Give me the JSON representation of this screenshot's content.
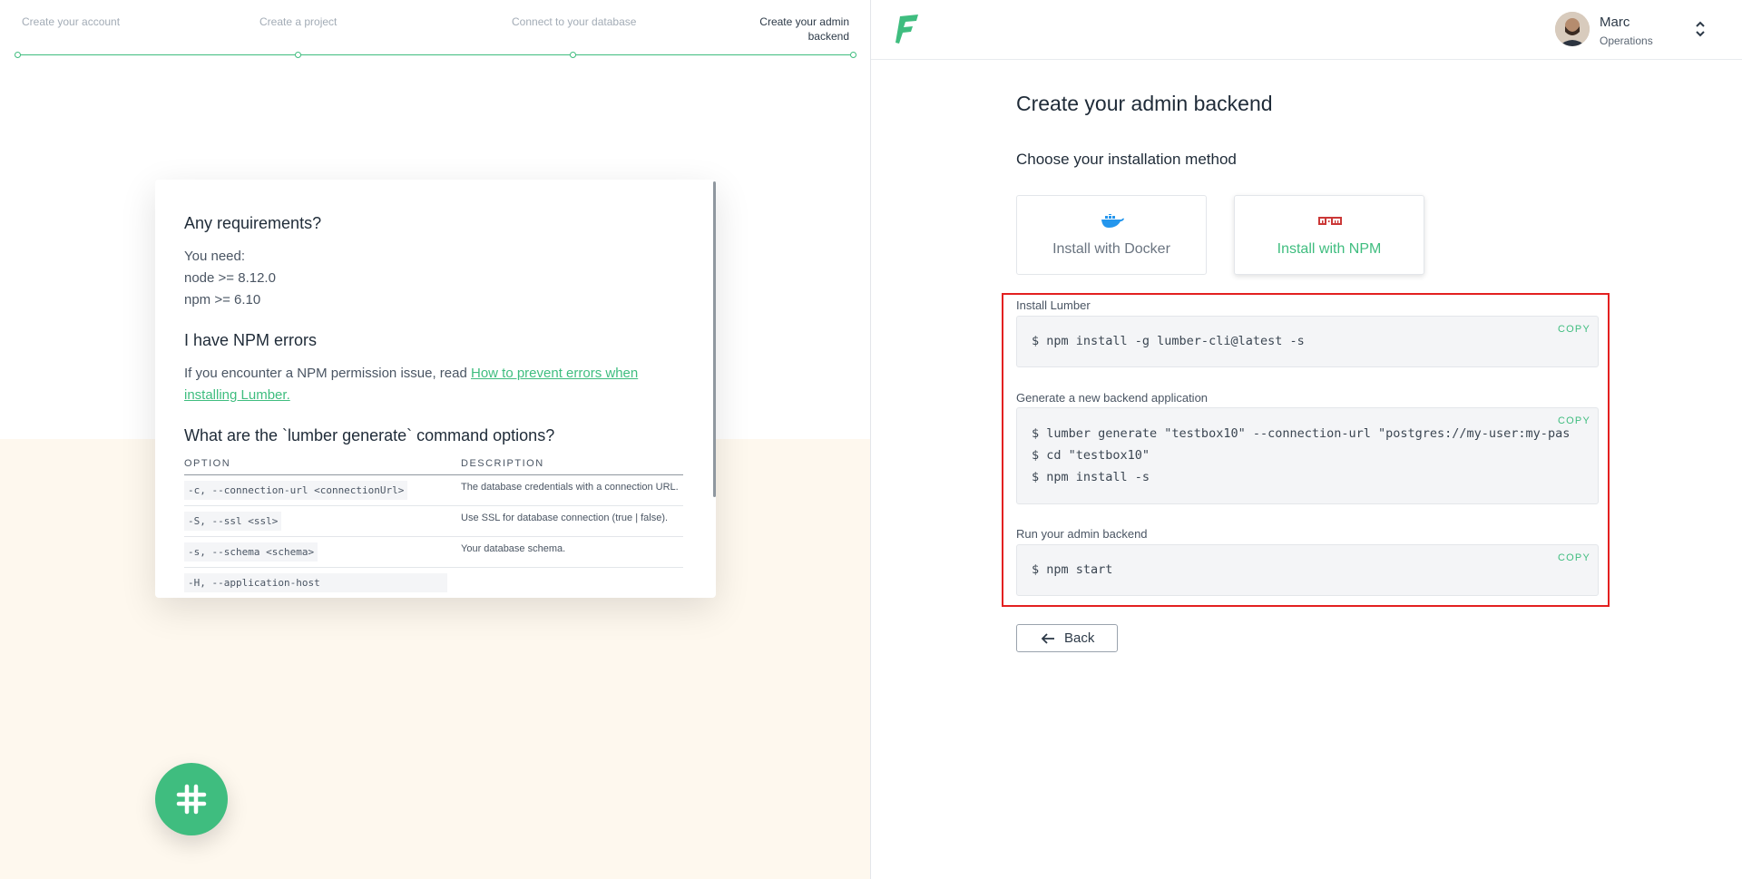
{
  "stepper": {
    "steps": [
      {
        "label": "Create your account"
      },
      {
        "label": "Create a project"
      },
      {
        "label": "Connect to your database"
      },
      {
        "label_line1": "Create your admin",
        "label_line2": "backend"
      }
    ],
    "accent_color": "#3fbd7f"
  },
  "help": {
    "requirements_title": "Any requirements?",
    "requirements_intro": "You need:",
    "requirement_node": "node >= 8.12.0",
    "requirement_npm": "npm >= 6.10",
    "npm_errors_title": "I have NPM errors",
    "npm_errors_text": "If you encounter a NPM permission issue, read ",
    "npm_errors_link": "How to prevent errors when installing Lumber.",
    "options_title": "What are the `lumber generate` command options?",
    "table_headers": {
      "option": "OPTION",
      "description": "DESCRIPTION"
    },
    "options": [
      {
        "option": "-c, --connection-url <connectionUrl>",
        "description": "The database credentials with a connection URL."
      },
      {
        "option": "-S, --ssl <ssl>",
        "description": "Use SSL for database connection (true | false)."
      },
      {
        "option": "-s, --schema <schema>",
        "description": "Your database schema."
      },
      {
        "option": "-H, --application-host",
        "description": ""
      }
    ]
  },
  "slack": {
    "icon": "slack-icon"
  },
  "header": {
    "logo": "forest-logo",
    "user_name": "Marc",
    "user_role": "Operations"
  },
  "main": {
    "title": "Create your admin backend",
    "subtitle": "Choose your installation method",
    "methods": [
      {
        "label": "Install with Docker",
        "icon": "docker-icon"
      },
      {
        "label": "Install with NPM",
        "icon": "npm-icon",
        "selected": true
      }
    ],
    "steps": [
      {
        "label": "Install Lumber",
        "copy": "COPY",
        "lines": [
          "$  npm install -g lumber-cli@latest -s"
        ]
      },
      {
        "label": "Generate a new backend application",
        "copy": "COPY",
        "lines": [
          "$  lumber generate \"testbox10\" --connection-url \"postgres://my-user:my-pas",
          "$  cd \"testbox10\"",
          "$  npm install -s"
        ]
      },
      {
        "label": "Run your admin backend",
        "copy": "COPY",
        "lines": [
          "$  npm start"
        ]
      }
    ],
    "back_label": "Back"
  }
}
